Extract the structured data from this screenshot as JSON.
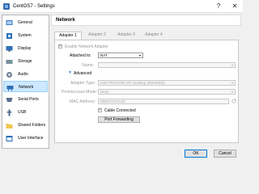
{
  "window": {
    "title": "CentOS7 - Settings",
    "help_glyph": "?",
    "close_glyph": "✕"
  },
  "sidebar": {
    "items": [
      {
        "label": "General"
      },
      {
        "label": "System"
      },
      {
        "label": "Display"
      },
      {
        "label": "Storage"
      },
      {
        "label": "Audio"
      },
      {
        "label": "Network",
        "selected": true
      },
      {
        "label": "Serial Ports"
      },
      {
        "label": "USB"
      },
      {
        "label": "Shared Folders"
      },
      {
        "label": "User Interface"
      }
    ]
  },
  "section": {
    "title": "Network"
  },
  "tabs": [
    {
      "label": "Adapter 1",
      "active": true
    },
    {
      "label": "Adapter 2"
    },
    {
      "label": "Adapter 3"
    },
    {
      "label": "Adapter 4"
    }
  ],
  "adapter": {
    "enable_label": "Enable Network Adapter",
    "enable_checked": true,
    "attached_label": "Attached to:",
    "attached_value": "NAT",
    "name_label": "Name:",
    "name_value": "",
    "advanced_label": "Advanced",
    "advanced_glyph": "▼",
    "dropdown_glyph": "▾",
    "type_label": "Adapter Type:",
    "type_value": "Intel PRO/1000 MT Desktop (82540EM)",
    "promiscuous_label": "Promiscuous Mode:",
    "promiscuous_value": "Deny",
    "mac_label": "MAC Address:",
    "mac_value": "080027447C32",
    "cable_label": "Cable Connected",
    "cable_checked": true,
    "port_forwarding_label": "Port Forwarding"
  },
  "footer": {
    "ok_label": "OK",
    "cancel_label": "Cancel"
  },
  "colors": {
    "accent": "#0078d7",
    "selection_bg": "#cde8ff",
    "selection_border": "#99d1ff",
    "section_blue": "#4b84c7"
  }
}
